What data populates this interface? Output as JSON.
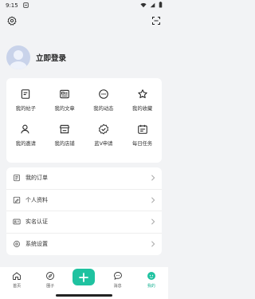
{
  "status_bar": {
    "time": "9:15"
  },
  "profile": {
    "login_label": "立即登录"
  },
  "grid": {
    "items": [
      {
        "label": "我的帖子",
        "icon": "post-icon"
      },
      {
        "label": "我的文章",
        "icon": "article-icon"
      },
      {
        "label": "我的动态",
        "icon": "moments-icon"
      },
      {
        "label": "我的收藏",
        "icon": "star-icon"
      },
      {
        "label": "我的邀请",
        "icon": "invite-icon"
      },
      {
        "label": "我的店铺",
        "icon": "shop-icon"
      },
      {
        "label": "蓝V申请",
        "icon": "verified-icon"
      },
      {
        "label": "每日任务",
        "icon": "calendar-icon"
      }
    ]
  },
  "list": {
    "items": [
      {
        "label": "我的订单",
        "icon": "order-icon"
      },
      {
        "label": "个人资料",
        "icon": "profile-edit-icon"
      },
      {
        "label": "实名认证",
        "icon": "id-card-icon"
      },
      {
        "label": "系统设置",
        "icon": "settings-icon"
      }
    ]
  },
  "tabbar": {
    "tabs": [
      {
        "label": "首页",
        "icon": "home-icon"
      },
      {
        "label": "圈子",
        "icon": "compass-icon"
      },
      {
        "label": "",
        "icon": "plus-icon"
      },
      {
        "label": "消息",
        "icon": "message-icon"
      },
      {
        "label": "我的",
        "icon": "me-icon"
      }
    ]
  },
  "colors": {
    "accent": "#1fc2a0",
    "background": "#f2f3f5",
    "card": "#ffffff"
  }
}
